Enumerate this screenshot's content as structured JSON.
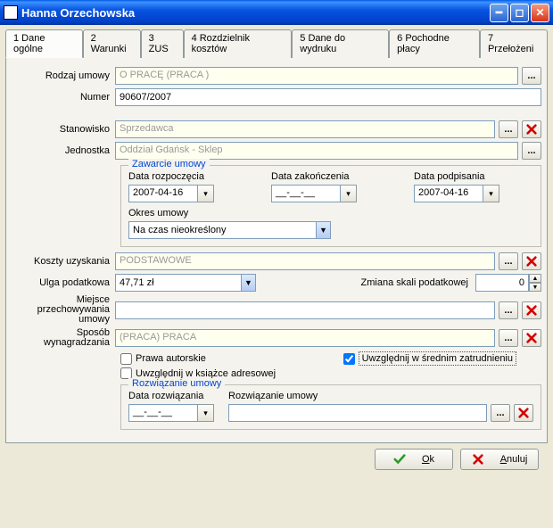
{
  "window": {
    "title": "Hanna Orzechowska"
  },
  "tabs": [
    "1 Dane ogólne",
    "2 Warunki",
    "3 ZUS",
    "4 Rozdzielnik kosztów",
    "5 Dane do wydruku",
    "6 Pochodne płacy",
    "7 Przełożeni"
  ],
  "labels": {
    "rodzaj_umowy": "Rodzaj umowy",
    "numer": "Numer",
    "stanowisko": "Stanowisko",
    "jednostka": "Jednostka",
    "zawarcie_umowy": "Zawarcie umowy",
    "data_rozpoczecia": "Data rozpoczęcia",
    "data_zakonczenia": "Data zakończenia",
    "data_podpisania": "Data podpisania",
    "okres_umowy": "Okres umowy",
    "koszty_uzyskania": "Koszty uzyskania",
    "ulga_podatkowa": "Ulga podatkowa",
    "zmiana_skali": "Zmiana skali podatkowej",
    "miejsce_przechowywania": "Miejsce przechowywania umowy",
    "sposob_wynagradzania": "Sposób wynagradzania",
    "prawa_autorskie": "Prawa autorskie",
    "uwzglednij_srednim": "Uwzględnij w średnim zatrudnieniu",
    "uwzglednij_ks_adr": "Uwzględnij w książce adresowej",
    "rozwiazanie_umowy_grp": "Rozwiązanie umowy",
    "data_rozwiazania": "Data rozwiązania",
    "rozwiazanie_umowy": "Rozwiązanie umowy"
  },
  "values": {
    "rodzaj_umowy": "O PRACĘ (PRACA     )",
    "numer": "90607/2007",
    "stanowisko": "Sprzedawca",
    "jednostka": "Oddział Gdańsk - Sklep",
    "data_rozpoczecia": "2007-04-16",
    "data_zakonczenia": "__-__-__",
    "data_podpisania": "2007-04-16",
    "okres_umowy": "Na czas nieokreślony",
    "koszty_uzyskania": "PODSTAWOWE",
    "ulga_podatkowa": "47,71 zł",
    "zmiana_skali": "0",
    "miejsce_przechowywania": "",
    "sposob_wynagradzania": "(PRACA) PRACA",
    "data_rozwiazania": "__-__-__",
    "rozwiazanie_umowy": ""
  },
  "checkboxes": {
    "prawa_autorskie": false,
    "uwzglednij_srednim": true,
    "uwzglednij_ks_adr": false
  },
  "buttons": {
    "ok_html": "<span class='underline'>O</span>k",
    "anuluj_html": "<span class='underline'>A</span>nuluj",
    "ellipsis": "..."
  }
}
